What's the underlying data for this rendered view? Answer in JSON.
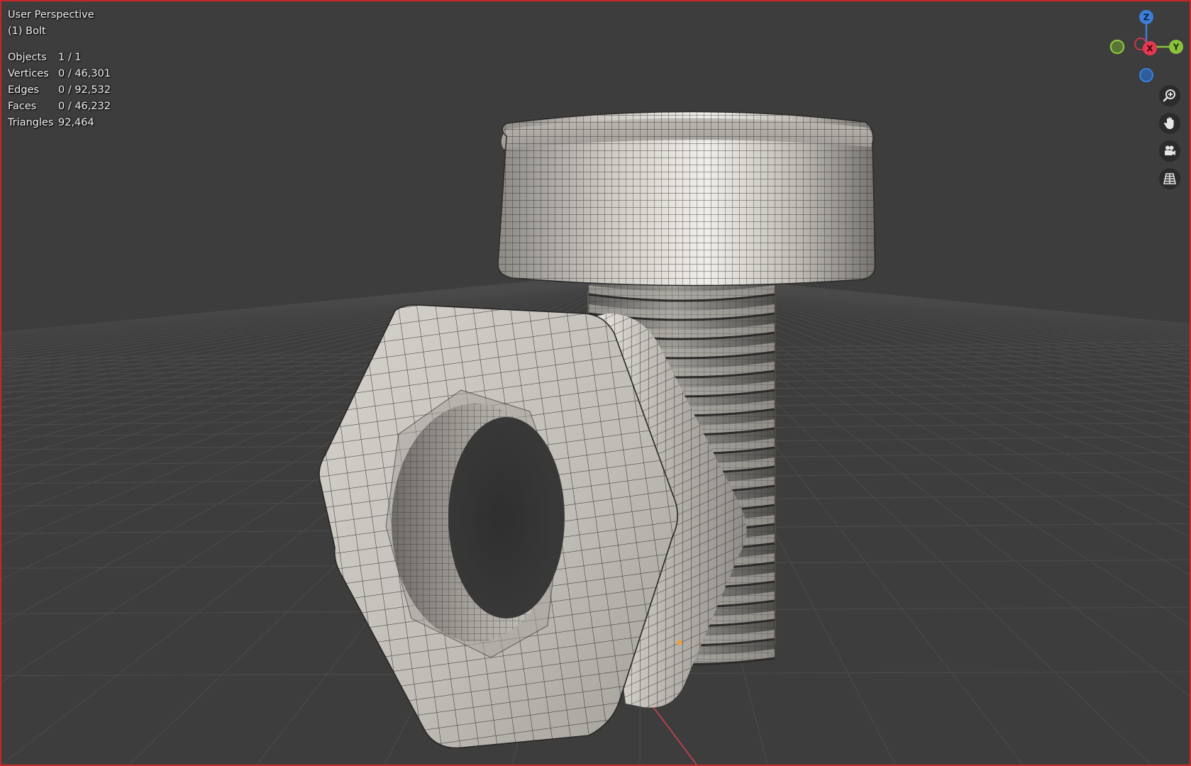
{
  "viewport": {
    "view_name": "User Perspective",
    "object_label": "(1) Bolt"
  },
  "stats": {
    "rows": [
      {
        "label": "Objects",
        "value": "1 / 1"
      },
      {
        "label": "Vertices",
        "value": "0 / 46,301"
      },
      {
        "label": "Edges",
        "value": "0 / 92,532"
      },
      {
        "label": "Faces",
        "value": "0 / 46,232"
      },
      {
        "label": "Triangles",
        "value": "92,464"
      }
    ]
  },
  "gizmo": {
    "z_label": "Z",
    "x_label": "X",
    "y_label": "Y",
    "colors": {
      "z": "#3b7fd9",
      "x": "#e8384f",
      "y": "#8ac23d"
    }
  },
  "nav_buttons": [
    {
      "name": "zoom-button",
      "icon": "zoom-in-icon"
    },
    {
      "name": "pan-button",
      "icon": "hand-icon"
    },
    {
      "name": "camera-view-button",
      "icon": "camera-icon"
    },
    {
      "name": "perspective-toggle-button",
      "icon": "grid-perspective-icon"
    }
  ],
  "colors": {
    "background": "#3d3d3d",
    "active_border": "#c8262b",
    "x_axis_line": "#c64450"
  }
}
